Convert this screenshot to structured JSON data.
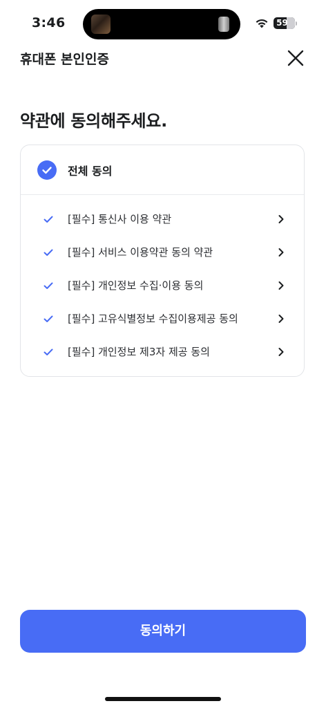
{
  "status_bar": {
    "time": "3:46",
    "battery_percent": "59",
    "battery_level": 0.59
  },
  "header": {
    "title": "휴대폰 본인인증",
    "close_icon": "close-icon"
  },
  "page_title": "약관에 동의해주세요.",
  "terms": {
    "agree_all_label": "전체 동의",
    "agree_all_checked": true,
    "items": [
      {
        "label": "[필수] 통신사 이용 약관",
        "checked": true
      },
      {
        "label": "[필수] 서비스 이용약관 동의 약관",
        "checked": true
      },
      {
        "label": "[필수] 개인정보 수집·이용 동의",
        "checked": true
      },
      {
        "label": "[필수] 고유식별정보 수집이용제공 동의",
        "checked": true
      },
      {
        "label": "[필수] 개인정보 제3자 제공 동의",
        "checked": true
      }
    ]
  },
  "agree_button_label": "동의하기",
  "colors": {
    "accent": "#486cf5",
    "text": "#1b1d1f",
    "border": "#e2e4e8"
  }
}
